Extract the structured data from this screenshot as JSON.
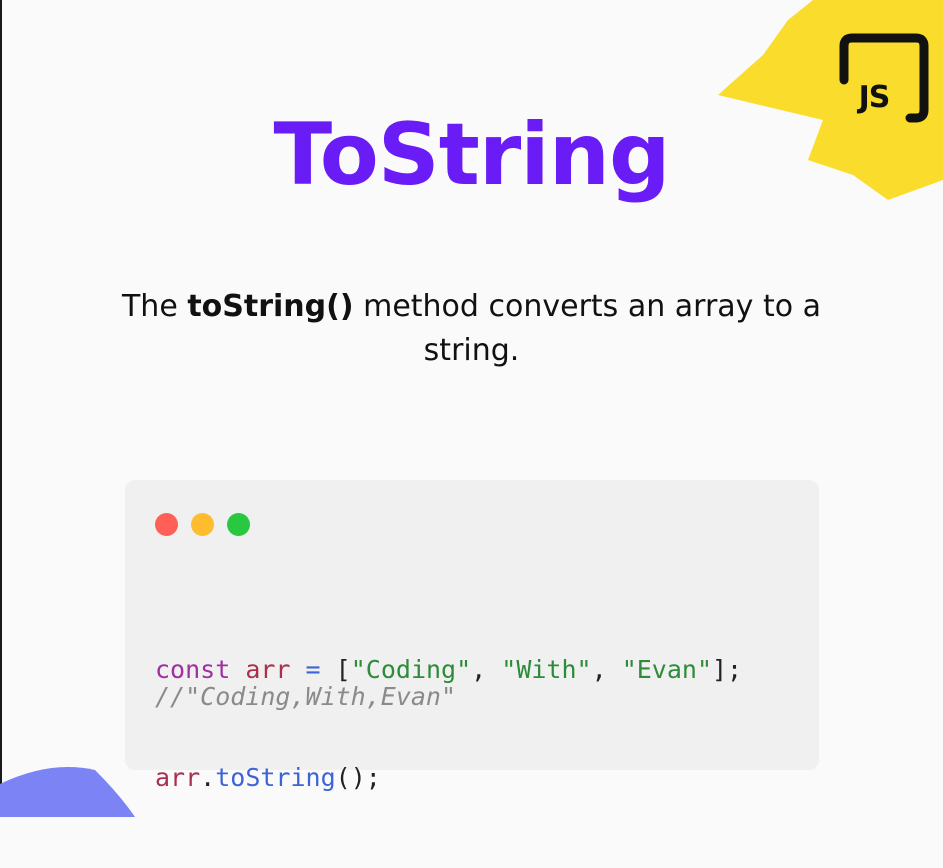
{
  "slide": {
    "title": "ToString",
    "logo_text": "JS",
    "description": {
      "before": "The ",
      "method": "toString()",
      "after": " method converts an array to a string."
    }
  },
  "code": {
    "window_dots": [
      "red-dot",
      "yellow-dot",
      "green-dot"
    ],
    "line1": {
      "keyword": "const",
      "var": "arr",
      "op": "=",
      "open": "[",
      "str1": "\"Coding\"",
      "sep1": ", ",
      "str2": "\"With\"",
      "sep2": ", ",
      "str3": "\"Evan\"",
      "close": "];"
    },
    "line2": {
      "var": "arr",
      "dot": ".",
      "method": "toString",
      "call": "();"
    },
    "comment": "//\"Coding,With,Evan\""
  },
  "colors": {
    "title": "#6a1cf6",
    "yellow_accent": "#fadc2c",
    "blue_accent": "#7b83f5",
    "red_dot": "#fe5f57",
    "yellow_dot": "#febc2e",
    "green_dot": "#28c840"
  }
}
